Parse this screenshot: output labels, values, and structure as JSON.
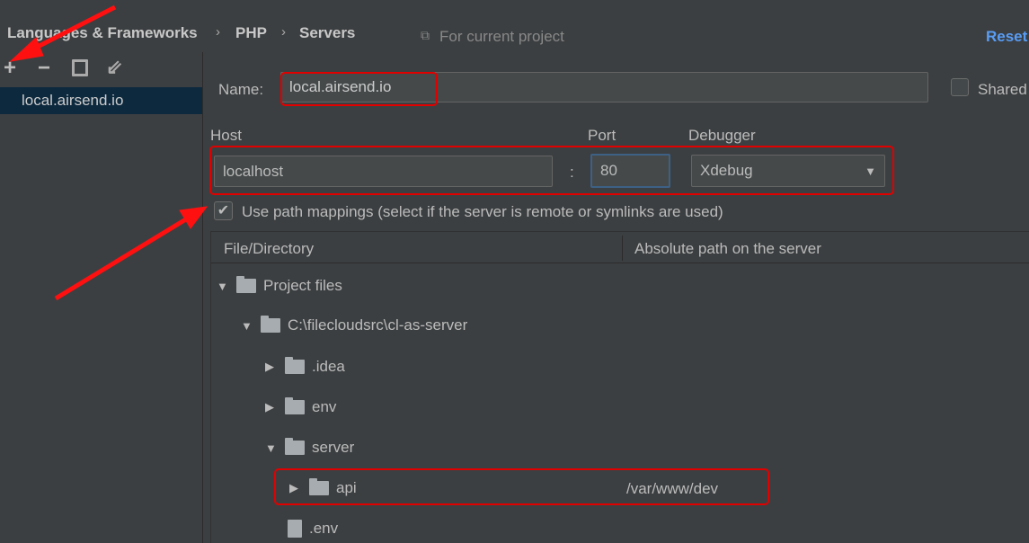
{
  "breadcrumb": [
    "Languages & Frameworks",
    "PHP",
    "Servers"
  ],
  "scope_label": "For current project",
  "reset_label": "Reset",
  "toolbar": {
    "add": "+",
    "remove": "−"
  },
  "servers": [
    "local.airsend.io"
  ],
  "form": {
    "name_label": "Name:",
    "name_value": "local.airsend.io",
    "shared_label": "Shared",
    "host_label": "Host",
    "host_value": "localhost",
    "port_label": "Port",
    "port_value": "80",
    "debugger_label": "Debugger",
    "debugger_value": "Xdebug",
    "colon": ":",
    "path_mappings_label": "Use path mappings (select if the server is remote or symlinks are used)",
    "path_mappings_checked": true
  },
  "table": {
    "columns": [
      "File/Directory",
      "Absolute path on the server"
    ],
    "rows": [
      {
        "name": "Project files",
        "expanded": true
      },
      {
        "name": "C:\\filecloudsrc\\cl-as-server",
        "expanded": true
      },
      {
        "name": ".idea",
        "expanded": false
      },
      {
        "name": "env",
        "expanded": false
      },
      {
        "name": "server",
        "expanded": true
      },
      {
        "name": "api",
        "expanded": false,
        "path": "/var/www/dev"
      },
      {
        "name": ".env"
      }
    ]
  },
  "colors": {
    "background": "#3c3f41",
    "selection": "#0d293e",
    "highlight": "#e00000",
    "accent": "#589df6"
  }
}
